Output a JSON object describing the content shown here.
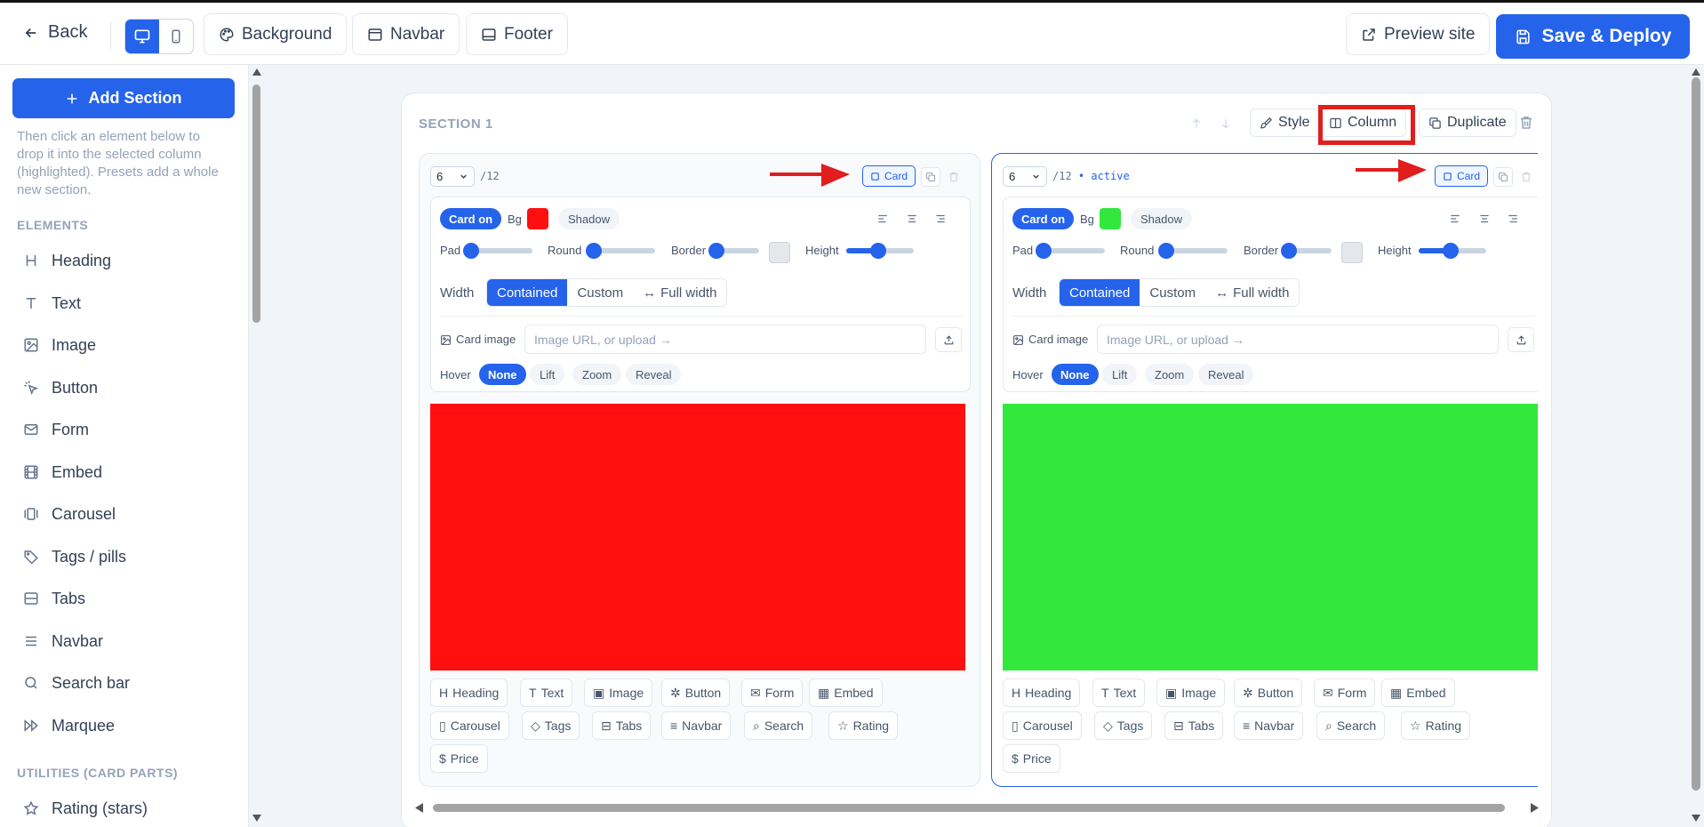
{
  "topbar": {
    "back_label": "Back",
    "background_label": "Background",
    "navbar_label": "Navbar",
    "footer_label": "Footer",
    "preview_label": "Preview site",
    "deploy_label": "Save & Deploy"
  },
  "sidebar": {
    "add_section_label": "Add Section",
    "hint": "Then click an element below to drop it into the selected column (highlighted). Presets add a whole new section.",
    "elements_heading": "ELEMENTS",
    "elements": [
      {
        "label": "Heading",
        "icon": "heading-icon"
      },
      {
        "label": "Text",
        "icon": "text-icon"
      },
      {
        "label": "Image",
        "icon": "image-icon"
      },
      {
        "label": "Button",
        "icon": "pointer-icon"
      },
      {
        "label": "Form",
        "icon": "mail-icon"
      },
      {
        "label": "Embed",
        "icon": "film-icon"
      },
      {
        "label": "Carousel",
        "icon": "carousel-icon"
      },
      {
        "label": "Tags / pills",
        "icon": "tag-icon"
      },
      {
        "label": "Tabs",
        "icon": "tabs-icon"
      },
      {
        "label": "Navbar",
        "icon": "menu-icon"
      },
      {
        "label": "Search bar",
        "icon": "search-icon"
      },
      {
        "label": "Marquee",
        "icon": "fast-forward-icon"
      }
    ],
    "utilities_heading": "UTILITIES (CARD PARTS)",
    "utilities": [
      {
        "label": "Rating (stars)",
        "icon": "star-icon"
      }
    ]
  },
  "section": {
    "title": "SECTION 1",
    "style_label": "Style",
    "column_label": "Column",
    "duplicate_label": "Duplicate"
  },
  "columns": [
    {
      "span": "6",
      "of": "/12",
      "active_label": "",
      "card_label": "Card",
      "card_on_label": "Card on",
      "bg_label": "Bg",
      "bg_color": "#ff0f0f",
      "shadow_label": "Shadow",
      "pad_label": "Pad",
      "round_label": "Round",
      "border_label": "Border",
      "height_label": "Height",
      "width_label": "Width",
      "width_options": [
        "Contained",
        "Custom",
        "Full width"
      ],
      "card_image_label": "Card image",
      "card_image_placeholder": "Image URL, or upload →",
      "hover_label": "Hover",
      "hover_options": [
        "None",
        "Lift",
        "Zoom",
        "Reveal"
      ],
      "block_color": "#ff0f0f",
      "elements": [
        "Heading",
        "Text",
        "Image",
        "Button",
        "Form",
        "Embed",
        "Carousel",
        "Tags",
        "Tabs",
        "Navbar",
        "Search",
        "Rating",
        "Price"
      ]
    },
    {
      "span": "6",
      "of": "/12",
      "active_label": "• active",
      "card_label": "Card",
      "card_on_label": "Card on",
      "bg_label": "Bg",
      "bg_color": "#33e83d",
      "shadow_label": "Shadow",
      "pad_label": "Pad",
      "round_label": "Round",
      "border_label": "Border",
      "height_label": "Height",
      "width_label": "Width",
      "width_options": [
        "Contained",
        "Custom",
        "Full width"
      ],
      "card_image_label": "Card image",
      "card_image_placeholder": "Image URL, or upload →",
      "hover_label": "Hover",
      "hover_options": [
        "None",
        "Lift",
        "Zoom",
        "Reveal"
      ],
      "block_color": "#33e83d",
      "elements": [
        "Heading",
        "Text",
        "Image",
        "Button",
        "Form",
        "Embed",
        "Carousel",
        "Tags",
        "Tabs",
        "Navbar",
        "Search",
        "Rating",
        "Price"
      ]
    }
  ],
  "colors": {
    "accent": "#2563eb",
    "annotation": "#e11d1d"
  }
}
